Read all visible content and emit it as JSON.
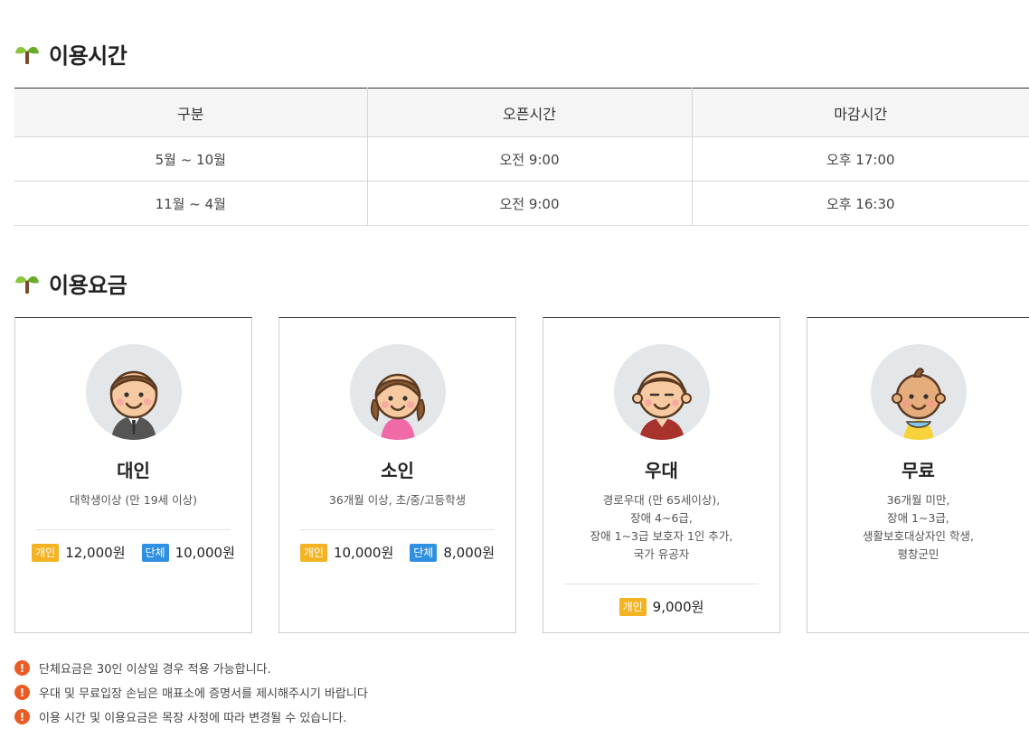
{
  "hours": {
    "title": "이용시간",
    "columns": [
      "구분",
      "오픈시간",
      "마감시간"
    ],
    "rows": [
      [
        "5월 ~ 10월",
        "오전 9:00",
        "오후 17:00"
      ],
      [
        "11월 ~ 4월",
        "오전 9:00",
        "오후 16:30"
      ]
    ]
  },
  "fees": {
    "title": "이용요금",
    "cards": [
      {
        "name": "대인",
        "desc": "대학생이상 (만 19세 이상)",
        "individual_label": "개인",
        "individual_price": "12,000원",
        "group_label": "단체",
        "group_price": "10,000원"
      },
      {
        "name": "소인",
        "desc": "36개월 이상, 초/중/고등학생",
        "individual_label": "개인",
        "individual_price": "10,000원",
        "group_label": "단체",
        "group_price": "8,000원"
      },
      {
        "name": "우대",
        "desc": "경로우대 (만 65세이상),\n장애 4~6급,\n장애 1~3급 보호자 1인 추가,\n국가 유공자",
        "individual_label": "개인",
        "individual_price": "9,000원"
      },
      {
        "name": "무료",
        "desc": "36개월 미만,\n장애 1~3급,\n생활보호대상자인 학생,\n평창군민"
      }
    ]
  },
  "notes": [
    "단체요금은 30인 이상일 경우 적용 가능합니다.",
    "우대 및 무료입장 손님은 매표소에 증명서를 제시해주시기 바랍니다",
    "이용 시간 및 이용요금은 목장 사정에 따라 변경될 수 있습니다."
  ],
  "icons": {
    "section": "sprout-icon",
    "note": "exclamation-icon",
    "avatars": [
      "adult-avatar-icon",
      "child-avatar-icon",
      "senior-avatar-icon",
      "baby-avatar-icon"
    ]
  },
  "colors": {
    "individual_badge": "#f3b323",
    "group_badge": "#2f8fe0",
    "warning": "#ea5b25"
  }
}
